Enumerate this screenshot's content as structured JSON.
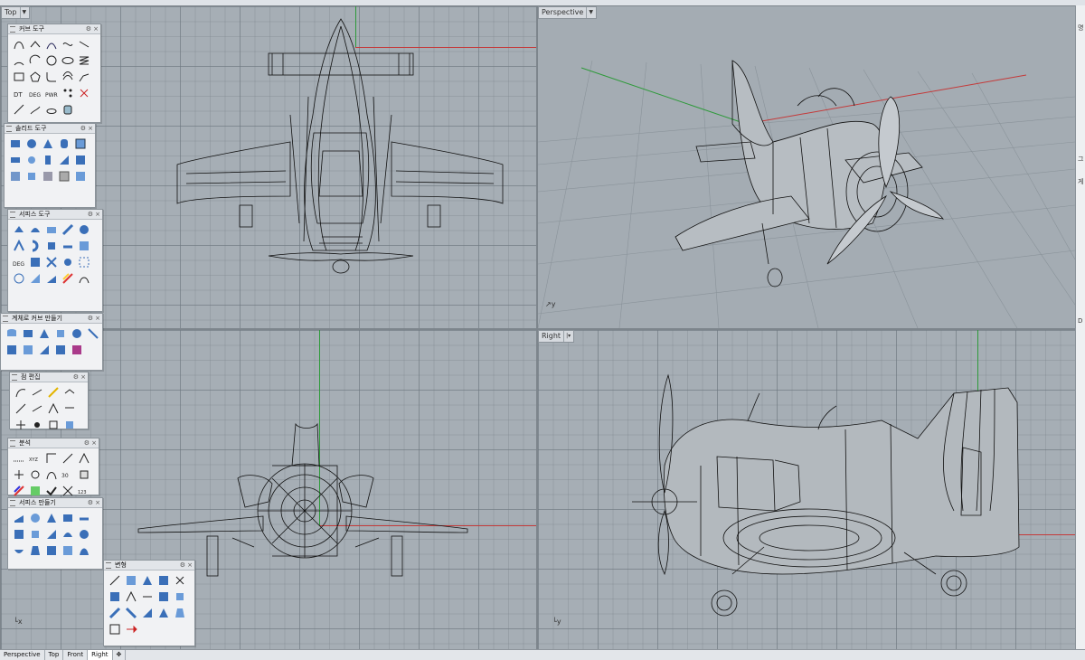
{
  "viewports": {
    "top": {
      "label": "Top"
    },
    "perspective": {
      "label": "Perspective"
    },
    "front": {
      "label": ""
    },
    "right": {
      "label": "Right"
    }
  },
  "panels": [
    {
      "title": "커브 도구"
    },
    {
      "title": "솔리드 도구"
    },
    {
      "title": "서피스 도구"
    },
    {
      "title": "계체로 커브 만들기"
    },
    {
      "title": "점 편집"
    },
    {
      "title": "분석"
    },
    {
      "title": "서피스 만들기"
    },
    {
      "title": "변형"
    }
  ],
  "tabs": [
    "Perspective",
    "Top",
    "Front",
    "Right"
  ],
  "active_tab": "Right",
  "tab_add_icon": "plus-icon",
  "colors": {
    "viewport_bg": "#a6aeb5",
    "x_axis": "#c43a3a",
    "y_axis": "#2e9a3a",
    "wireframe": "#111111"
  },
  "right_panel_labels": [
    "명",
    "그",
    "게",
    "D"
  ]
}
